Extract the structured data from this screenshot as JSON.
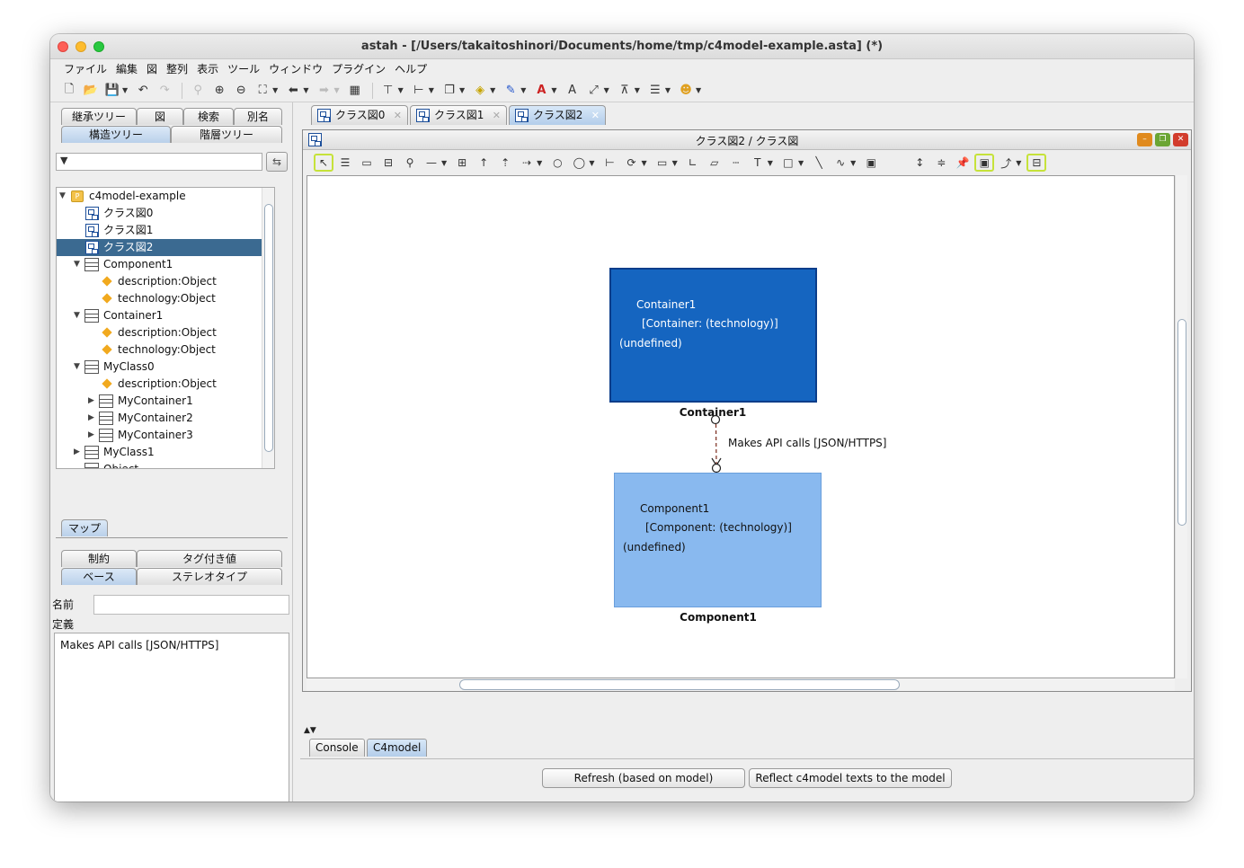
{
  "window": {
    "title": "astah - [/Users/takaitoshinori/Documents/home/tmp/c4model-example.asta] (*)"
  },
  "menu": [
    "ファイル",
    "編集",
    "図",
    "整列",
    "表示",
    "ツール",
    "ウィンドウ",
    "プラグイン",
    "ヘルプ"
  ],
  "left": {
    "tabs_row1": [
      "継承ツリー",
      "図",
      "検索",
      "別名"
    ],
    "tabs_row2": [
      "構造ツリー",
      "階層ツリー"
    ],
    "filter_icon": "filter-icon",
    "tree": [
      {
        "label": "c4model-example",
        "icon": "package-icon"
      },
      {
        "label": "クラス図0",
        "icon": "class-diagram-icon"
      },
      {
        "label": "クラス図1",
        "icon": "class-diagram-icon"
      },
      {
        "label": "クラス図2",
        "icon": "class-diagram-icon",
        "selected": true
      },
      {
        "label": "Component1",
        "icon": "class-icon"
      },
      {
        "label": "description:Object",
        "icon": "attribute-icon"
      },
      {
        "label": "technology:Object",
        "icon": "attribute-icon"
      },
      {
        "label": "Container1",
        "icon": "class-icon"
      },
      {
        "label": "description:Object",
        "icon": "attribute-icon"
      },
      {
        "label": "technology:Object",
        "icon": "attribute-icon"
      },
      {
        "label": "MyClass0",
        "icon": "class-icon"
      },
      {
        "label": "description:Object",
        "icon": "attribute-icon"
      },
      {
        "label": "MyContainer1",
        "icon": "class-icon"
      },
      {
        "label": "MyContainer2",
        "icon": "class-icon"
      },
      {
        "label": "MyContainer3",
        "icon": "class-icon"
      },
      {
        "label": "MyClass1",
        "icon": "class-icon"
      },
      {
        "label": "Object",
        "icon": "class-icon"
      }
    ],
    "map_tab": "マップ",
    "prop_tabs_row1": [
      "制約",
      "タグ付き値"
    ],
    "prop_tabs_row2": [
      "ベース",
      "ステレオタイプ"
    ],
    "name_label": "名前",
    "name_value": "",
    "definition_label": "定義",
    "definition_value": "Makes API calls [JSON/HTTPS]"
  },
  "diagram_tabs": [
    "クラス図0",
    "クラス図1",
    "クラス図2"
  ],
  "diagram": {
    "title": "クラス図2 / クラス図",
    "container": {
      "lines": [
        "Container1",
        "[Container: (technology)]",
        "(undefined)"
      ],
      "caption": "Container1",
      "color": "#1565c0"
    },
    "component": {
      "lines": [
        "Component1",
        "[Component: (technology)]",
        "(undefined)"
      ],
      "caption": "Component1",
      "color": "#89b9ef"
    },
    "relation_label": "Makes API calls [JSON/HTTPS]"
  },
  "bottom_tabs": [
    "Console",
    "C4model"
  ],
  "buttons": {
    "refresh": "Refresh (based on model)",
    "reflect": "Reflect c4model texts to the model"
  }
}
